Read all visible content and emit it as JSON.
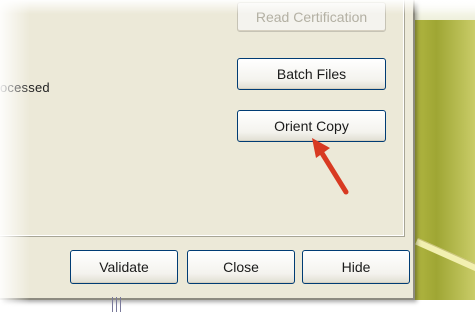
{
  "dialog": {
    "status_text": "ocessed",
    "buttons": {
      "read_certification": "Read Certification",
      "batch_files": "Batch Files",
      "orient_copy": "Orient Copy"
    },
    "footer": {
      "validate": "Validate",
      "close": "Close",
      "hide": "Hide"
    }
  },
  "icons": {
    "annotation_arrow": "red-arrow-icon",
    "arrow_color": "#d83a22"
  }
}
